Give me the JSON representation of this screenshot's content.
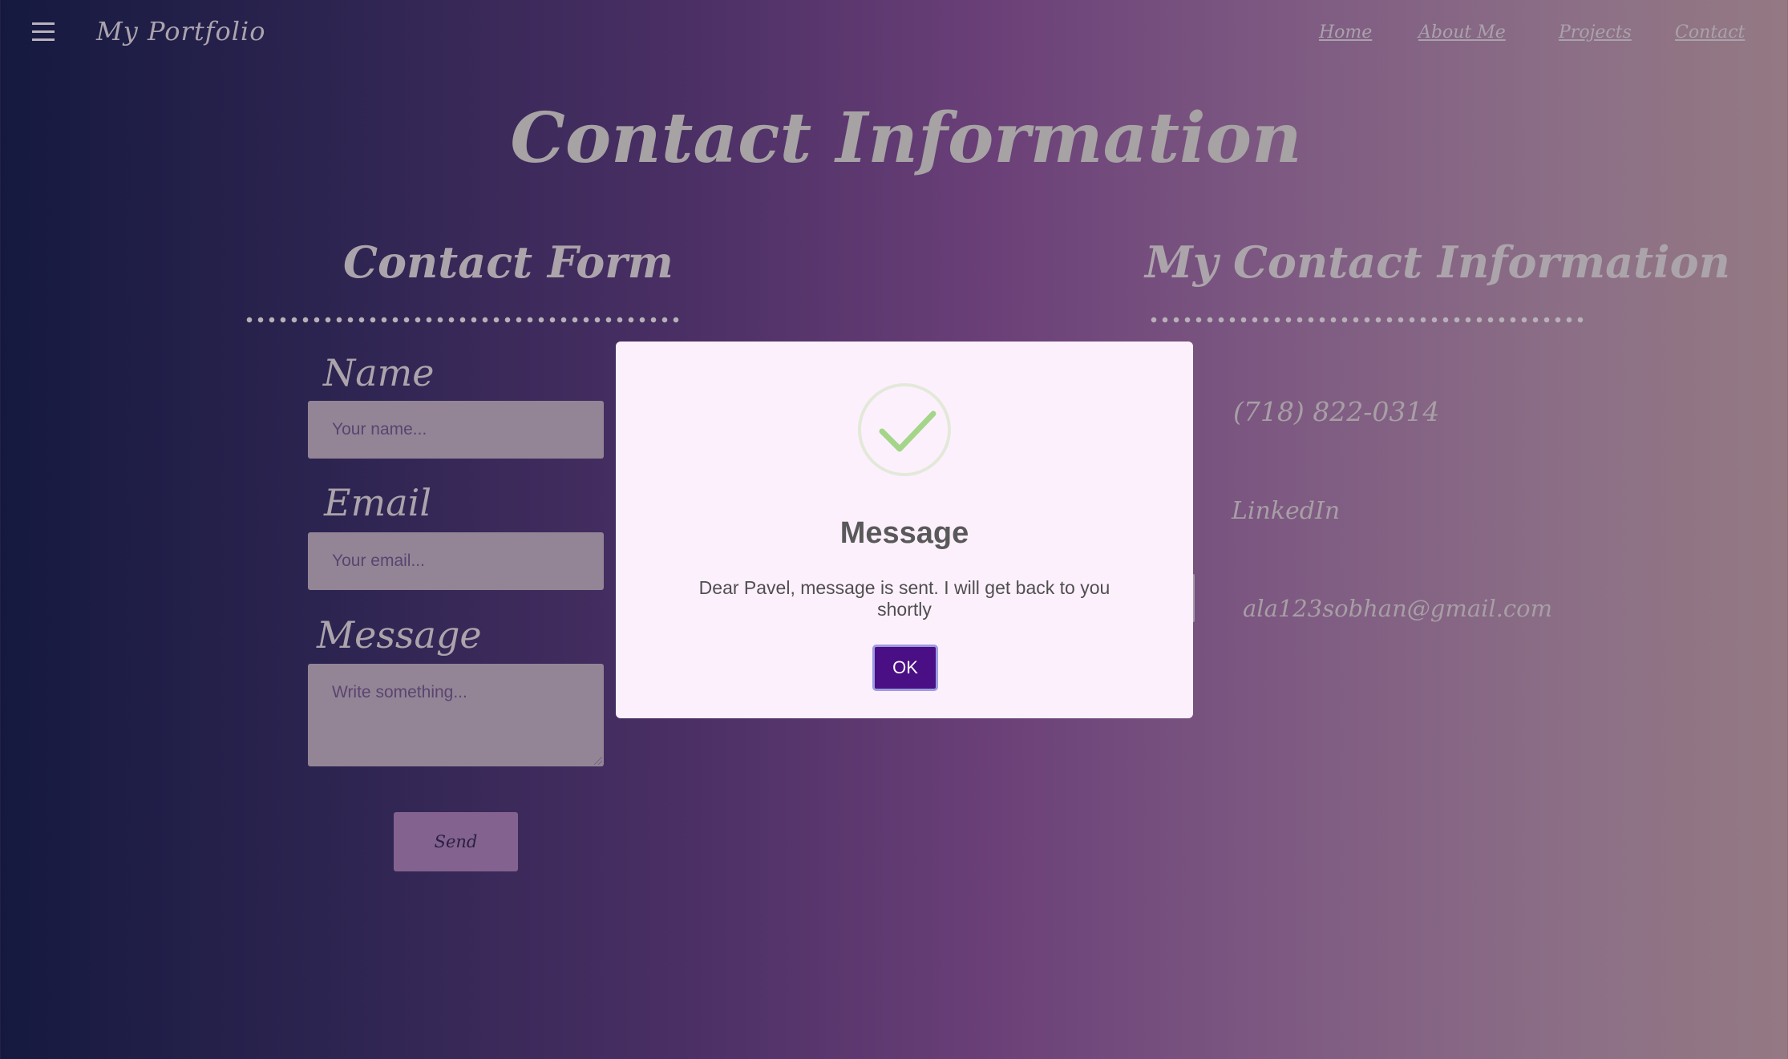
{
  "nav": {
    "brand": "My Portfolio",
    "links": [
      "Home",
      "About Me",
      "Projects",
      "Contact"
    ]
  },
  "page_title": "Contact Information",
  "form": {
    "title": "Contact Form",
    "name_label": "Name",
    "name_placeholder": "Your name...",
    "email_label": "Email",
    "email_placeholder": "Your email...",
    "message_label": "Message",
    "message_placeholder": "Write something...",
    "send_label": "Send"
  },
  "contact_info": {
    "title": "My Contact Information",
    "phone": "(718) 822-0314",
    "linkedin": "LinkedIn",
    "email": "ala123sobhan@gmail.com"
  },
  "modal": {
    "icon": "success-check-icon",
    "title": "Message",
    "text": "Dear Pavel, message is sent. I will get back to you shortly",
    "ok_label": "OK"
  },
  "colors": {
    "modal_bg": "#fdf0fd",
    "ok_button": "#4a0e85",
    "check": "#a4d68a"
  }
}
